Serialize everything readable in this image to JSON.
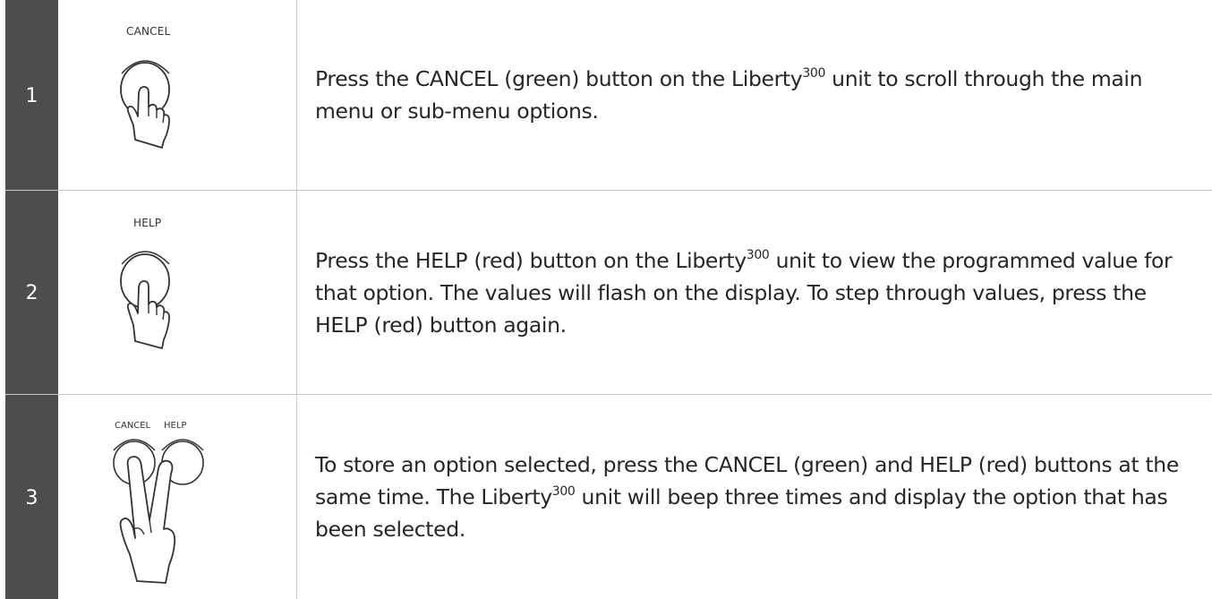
{
  "steps": [
    {
      "number": "1",
      "button_labels": [
        "CANCEL"
      ],
      "icon": "single-finger-press-icon",
      "text_before": "Press the CANCEL (green) button on the Liberty",
      "sup": "300",
      "text_after": " unit to scroll through the main menu or sub-menu options."
    },
    {
      "number": "2",
      "button_labels": [
        "HELP"
      ],
      "icon": "single-finger-press-icon",
      "text_before": "Press the HELP (red) button on the Liberty",
      "sup": "300",
      "text_after": " unit to view the programmed value for that option. The values will flash on the display. To step through values, press the HELP (red) button again."
    },
    {
      "number": "3",
      "button_labels": [
        "CANCEL",
        "HELP"
      ],
      "icon": "two-finger-press-icon",
      "text_before": "To store an option selected, press the CANCEL (green) and HELP (red) buttons at the same time. The Liberty",
      "sup": "300",
      "text_after": " unit will beep three times and display the option that has been selected."
    }
  ]
}
